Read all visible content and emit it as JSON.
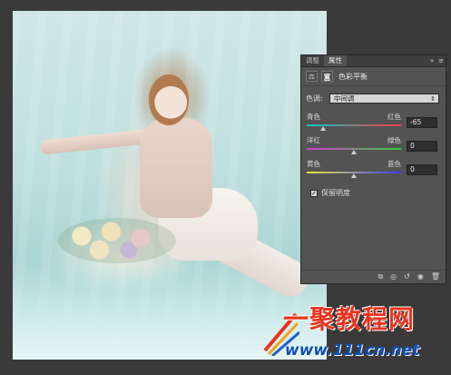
{
  "panel": {
    "tabs": [
      "调整",
      "属性"
    ],
    "tab_right_icons": [
      "»",
      "≡"
    ],
    "title": "色彩平衡",
    "tone_label": "色调:",
    "tone_value": "中间调",
    "sliders": [
      {
        "left": "青色",
        "right": "红色",
        "value": "-65",
        "level": -65,
        "gradient": [
          "#00c8c8",
          "#ff3b3b"
        ]
      },
      {
        "left": "洋红",
        "right": "绿色",
        "value": "0",
        "level": 0,
        "gradient": [
          "#d63bd6",
          "#2fcf2f"
        ]
      },
      {
        "left": "黄色",
        "right": "蓝色",
        "value": "0",
        "level": 0,
        "gradient": [
          "#e8e83a",
          "#3b3bff"
        ]
      }
    ],
    "preserve_luminosity_label": "保留明度",
    "bottom_icons": [
      "clip-to-layer-icon",
      "visibility-eye-icon",
      "reset-icon",
      "toggle-visibility-icon",
      "trash-icon"
    ]
  },
  "watermark": {
    "line1": "一聚教程网",
    "line2": "www.111cn.net"
  }
}
